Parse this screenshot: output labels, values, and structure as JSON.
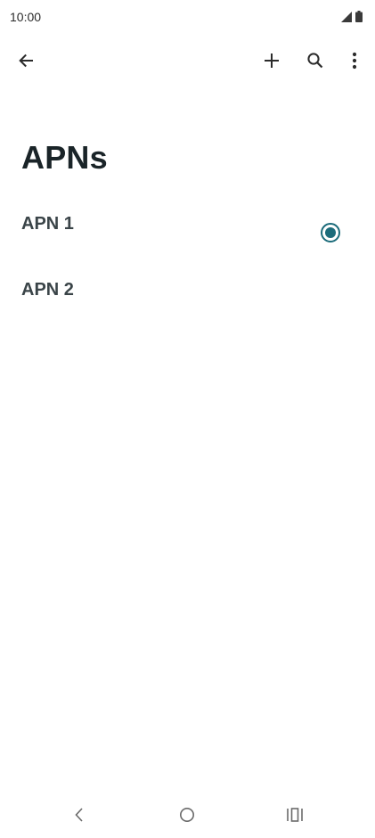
{
  "status_bar": {
    "time": "10:00"
  },
  "toolbar": {
    "back_icon": "arrow-left-icon",
    "add_icon": "plus-icon",
    "search_icon": "search-icon",
    "more_icon": "more-vert-icon"
  },
  "page": {
    "title": "APNs"
  },
  "apn_list": {
    "items": [
      {
        "label": "APN 1",
        "selected": true
      },
      {
        "label": "APN 2",
        "selected": false
      }
    ]
  },
  "colors": {
    "accent": "#1b6b7a",
    "text_primary": "#1a2428",
    "text_item": "#3a4448",
    "icon": "#2b2b2b",
    "background": "#ffffff"
  }
}
